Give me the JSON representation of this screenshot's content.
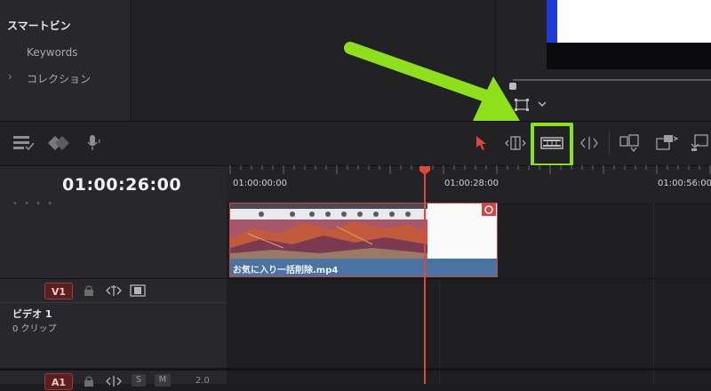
{
  "media_pool": {
    "smart_bin": "スマートビン",
    "keywords": "Keywords",
    "collection": "コレクション"
  },
  "timeline": {
    "timecode": "01:00:26:00",
    "ruler_labels": [
      "01:00:00:00",
      "01:00:28:00",
      "01:00:56:00"
    ]
  },
  "tracks": {
    "v1_label": "V1",
    "v1_name": "ビデオ 1",
    "v1_clip_count": "0 クリップ",
    "a1_label": "A1",
    "a1_solo": "S",
    "a1_mute": "M",
    "a1_volume": "2.0"
  },
  "clip": {
    "filename": "お気に入り一括削除.mp4"
  },
  "colors": {
    "highlight": "#8ee01c",
    "playhead": "#e0473c",
    "clip_blue": "#4873a3"
  }
}
